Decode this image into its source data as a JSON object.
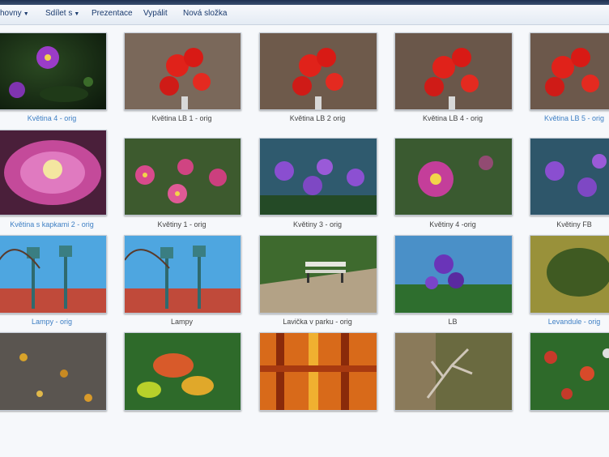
{
  "toolbar": {
    "items": [
      "hovny",
      "Sdílet s",
      "Prezentace",
      "Vypálit",
      "Nová složka"
    ]
  },
  "thumbnails": [
    {
      "caption": "Květina 4 - orig",
      "icon": "purple-flower-image"
    },
    {
      "caption": "Květina LB 1 - orig",
      "icon": "red-flowers-image"
    },
    {
      "caption": "Květina LB 2 orig",
      "icon": "red-flowers-image"
    },
    {
      "caption": "Květina LB 4 - orig",
      "icon": "red-flowers-image"
    },
    {
      "caption": "Květina LB 5 - orig",
      "icon": "red-flowers-image"
    },
    {
      "caption": "Květina s kapkami 2 - orig",
      "icon": "pink-flower-drops-image"
    },
    {
      "caption": "Květiny 1 - orig",
      "icon": "pink-flowers-image"
    },
    {
      "caption": "Květiny 3 - orig",
      "icon": "violet-flowers-image"
    },
    {
      "caption": "Květiny 4 -orig",
      "icon": "pink-flower-image"
    },
    {
      "caption": "Květiny FB",
      "icon": "violet-flowers-image"
    },
    {
      "caption": "Lampy - orig",
      "icon": "street-lamps-image"
    },
    {
      "caption": "Lampy",
      "icon": "street-lamps-image"
    },
    {
      "caption": "Lavička v parku - orig",
      "icon": "park-bench-image"
    },
    {
      "caption": "LB",
      "icon": "purple-bellflower-image"
    },
    {
      "caption": "Levandule - orig",
      "icon": "lavender-image"
    },
    {
      "caption": "",
      "icon": "autumn-leaves-ground-image"
    },
    {
      "caption": "",
      "icon": "autumn-leaves-image"
    },
    {
      "caption": "",
      "icon": "orange-pattern-image"
    },
    {
      "caption": "",
      "icon": "dry-branch-image"
    },
    {
      "caption": "",
      "icon": "red-leaves-image"
    }
  ],
  "colors": {
    "accent": "#1a3a6e",
    "selected_caption": "#3e7fc4"
  }
}
